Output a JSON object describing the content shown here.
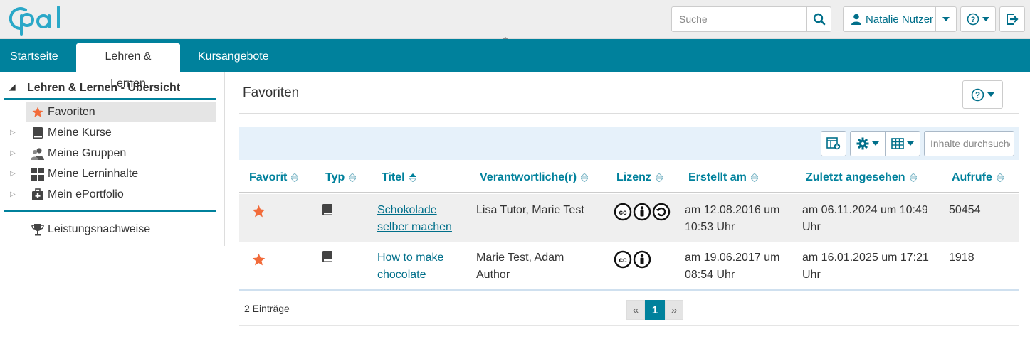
{
  "header": {
    "logo_text": "Opal",
    "search_placeholder": "Suche",
    "user_name": "Natalie Nutzer"
  },
  "nav": {
    "tabs": [
      {
        "label": "Startseite",
        "active": false
      },
      {
        "label": "Lehren & Lernen",
        "active": true
      },
      {
        "label": "Kursangebote",
        "active": false
      }
    ]
  },
  "sidebar": {
    "heading": "Lehren & Lernen - Übersicht",
    "items": [
      {
        "label": "Favoriten",
        "icon": "star-icon",
        "active": true
      },
      {
        "label": "Meine Kurse",
        "icon": "book-icon",
        "expandable": true
      },
      {
        "label": "Meine Gruppen",
        "icon": "group-icon",
        "expandable": true
      },
      {
        "label": "Meine Lerninhalte",
        "icon": "grid-icon",
        "expandable": true
      },
      {
        "label": "Mein ePortfolio",
        "icon": "portfolio-icon",
        "expandable": true
      }
    ],
    "extra_item": {
      "label": "Leistungsnachweise",
      "icon": "trophy-icon"
    }
  },
  "main": {
    "title": "Favoriten",
    "filter_placeholder": "Inhalte durchsuchen",
    "columns": [
      "Favorit",
      "Typ",
      "Titel",
      "Verantwortliche(r)",
      "Lizenz",
      "Erstellt am",
      "Zuletzt angesehen",
      "Aufrufe"
    ],
    "rows": [
      {
        "title_line1": "Schokolade",
        "title_line2": "selber machen",
        "owners": "Lisa Tutor, Marie Test",
        "owners_line2": "",
        "license": "CC BY-SA",
        "created_line1": "am 12.08.2016 um",
        "created_line2": "10:53 Uhr",
        "viewed_line1": "am 06.11.2024 um 10:49",
        "viewed_line2": "Uhr",
        "views": "50454"
      },
      {
        "title_line1": "How to make",
        "title_line2": "chocolate",
        "owners": "Marie Test, Adam",
        "owners_line2": "Author",
        "license": "CC BY",
        "created_line1": "am 19.06.2017 um",
        "created_line2": "08:54 Uhr",
        "viewed_line1": "am 16.01.2025 um 17:21",
        "viewed_line2": "Uhr",
        "views": "1918"
      }
    ],
    "count_label": "2 Einträge",
    "pager": {
      "prev": "«",
      "current": "1",
      "next": "»"
    }
  },
  "colors": {
    "primary": "#00819c",
    "link": "#006f8a",
    "star": "#f26b3a",
    "toolbar_bg": "#e6f1fa"
  }
}
